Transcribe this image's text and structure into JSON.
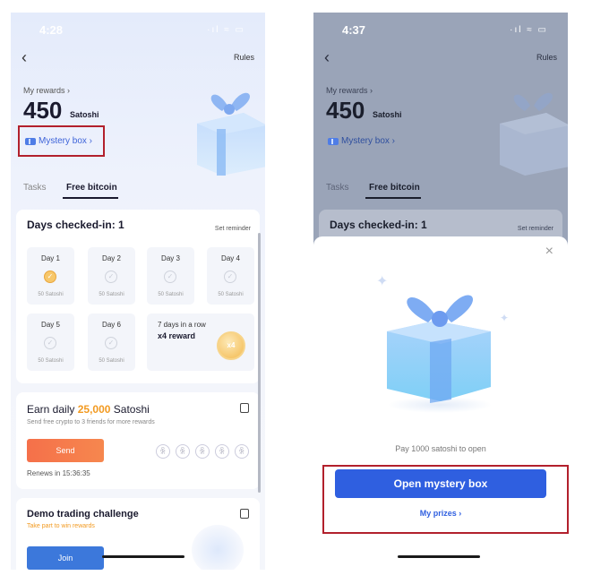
{
  "left": {
    "status_time": "4:28",
    "status_icons": "·ıl ≈ ▭",
    "back": "‹",
    "rules": "Rules",
    "my_rewards": "My rewards ›",
    "points": "450",
    "unit": "Satoshi",
    "mystery_box": "Mystery box ›",
    "tabs": {
      "tasks": "Tasks",
      "free": "Free bitcoin"
    },
    "checkin": {
      "title": "Days checked-in: 1",
      "reminder": "Set reminder",
      "days": [
        {
          "label": "Day 1",
          "reward": "50 Satoshi",
          "checked": true
        },
        {
          "label": "Day 2",
          "reward": "50 Satoshi",
          "checked": false
        },
        {
          "label": "Day 3",
          "reward": "50 Satoshi",
          "checked": false
        },
        {
          "label": "Day 4",
          "reward": "50 Satoshi",
          "checked": false
        },
        {
          "label": "Day 5",
          "reward": "50 Satoshi",
          "checked": false
        },
        {
          "label": "Day 6",
          "reward": "50 Satoshi",
          "checked": false
        }
      ],
      "day7_line1": "7 days in a row",
      "day7_line2": "x4 reward",
      "coin_label": "x4"
    },
    "earn": {
      "prefix": "Earn daily",
      "amount": "25,000",
      "suffix": "Satoshi",
      "subtitle": "Send free crypto to 3 friends for more rewards",
      "send": "Send",
      "renews": "Renews in 15:36:35"
    },
    "demo": {
      "title": "Demo trading challenge",
      "subtitle": "Take part to win rewards",
      "join": "Join"
    }
  },
  "right": {
    "status_time": "4:37",
    "status_icons": "·ıl ≈ ▭",
    "back": "‹",
    "rules": "Rules",
    "my_rewards": "My rewards ›",
    "points": "450",
    "unit": "Satoshi",
    "mystery_box": "Mystery box ›",
    "tabs": {
      "tasks": "Tasks",
      "free": "Free bitcoin"
    },
    "days_title": "Days checked-in: 1",
    "reminder": "Set reminder",
    "sheet": {
      "close": "×",
      "pay_text": "Pay 1000 satoshi to open",
      "open_button": "Open mystery box",
      "my_prizes": "My prizes ›"
    }
  },
  "colors": {
    "accent_blue": "#2f5fe0",
    "orange": "#f29a21",
    "highlight_red": "#b2202c"
  }
}
